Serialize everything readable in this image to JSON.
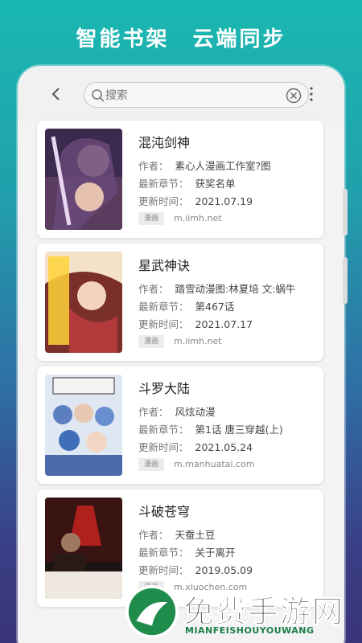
{
  "headline": "智能书架　云端同步",
  "search": {
    "placeholder": "搜索"
  },
  "labels": {
    "author": "作者：",
    "latest": "最新章节：",
    "updated": "更新时间："
  },
  "books": [
    {
      "title": "混沌剑神",
      "author": "素心人漫画工作室?图",
      "latest_chapter": "获奖名单",
      "updated": "2021.07.19",
      "tag": "漫画",
      "source": "m.iimh.net"
    },
    {
      "title": "星武神诀",
      "author": "踏雪动漫图:林夏培 文:蜗牛",
      "latest_chapter": "第467话",
      "updated": "2021.07.17",
      "tag": "漫画",
      "source": "m.iimh.net"
    },
    {
      "title": "斗罗大陆",
      "author": "风炫动漫",
      "latest_chapter": "第1话 唐三穿越(上)",
      "updated": "2021.05.24",
      "tag": "漫画",
      "source": "m.manhuatai.com"
    },
    {
      "title": "斗破苍穹",
      "author": "天蚕土豆",
      "latest_chapter": "关于离开",
      "updated": "2019.05.09",
      "tag": "漫画",
      "source": "m.xluochen.com"
    }
  ],
  "watermark": {
    "text": "免费手游网",
    "sub": "MIANFEISHOUYOUWANG"
  }
}
